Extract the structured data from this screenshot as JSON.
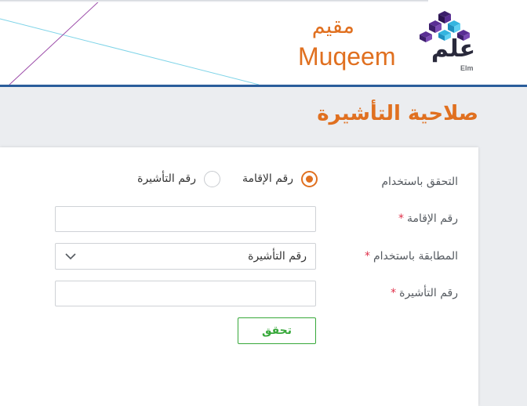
{
  "header": {
    "brand_ar": "مقيم",
    "brand_en": "Muqeem",
    "elm_word": "علم",
    "elm_caption": "Elm",
    "brand_color": "#e07020",
    "header_line_color": "#2a5d9b"
  },
  "page": {
    "title": "صلاحية التأشيرة"
  },
  "form": {
    "verify_by_label": "التحقق باستخدام",
    "options": [
      {
        "label": "رقم الإقامة",
        "checked": true
      },
      {
        "label": "رقم التأشيرة",
        "checked": false
      }
    ],
    "iqama_label": "رقم الإقامة",
    "iqama_value": "",
    "match_label": "المطابقة باستخدام",
    "match_selected": "رقم التأشيرة",
    "visa_label": "رقم التأشيرة",
    "visa_value": "",
    "required_mark": "*",
    "verify_button": "تحقق",
    "button_color": "#37a83a"
  }
}
